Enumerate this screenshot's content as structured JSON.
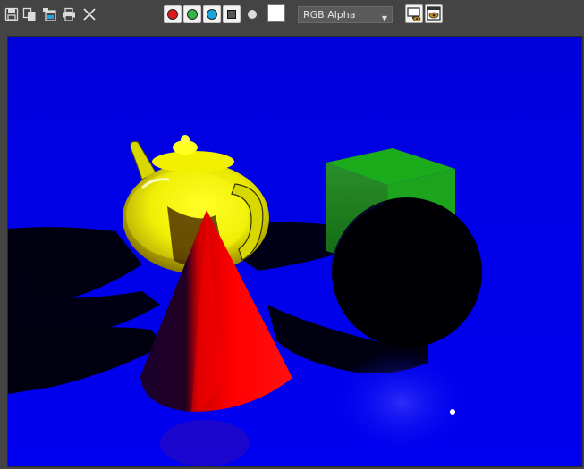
{
  "toolbar": {
    "icons": [
      "save-icon",
      "copy-icon",
      "clone-window-icon",
      "print-icon",
      "close-icon"
    ],
    "channels": {
      "red_color": "#e01b1b",
      "green_color": "#36b34a",
      "blue_color": "#17a7e0"
    },
    "channel_display": {
      "selected": "RGB Alpha"
    },
    "swatch_color": "#ffffff"
  },
  "render": {
    "background_color": "#0000ff",
    "objects": [
      "teapot",
      "cone",
      "box",
      "sphere"
    ],
    "object_colors": {
      "teapot": "#ffff00",
      "cone": "#ff0000",
      "box": "#1aa31a",
      "sphere": "#000000"
    }
  }
}
